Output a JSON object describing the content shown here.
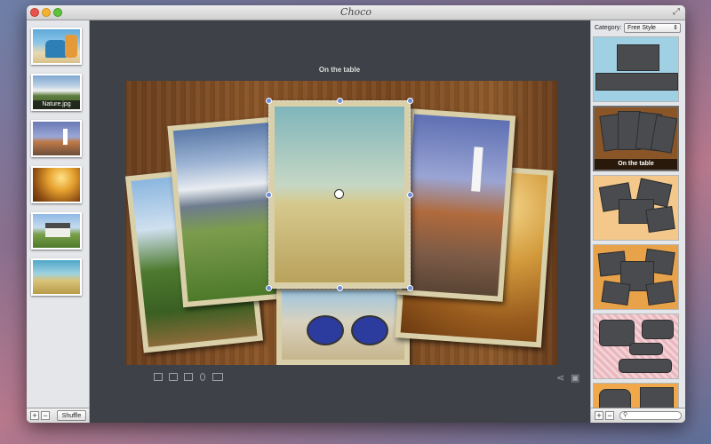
{
  "window": {
    "title": "Choco",
    "fullscreen_icon": "expand-icon"
  },
  "left_sidebar": {
    "thumbnails": [
      {
        "name": "thumb-beach-chairs",
        "label": ""
      },
      {
        "name": "thumb-nature",
        "label": "Nature.jpg"
      },
      {
        "name": "thumb-lighthouse",
        "label": ""
      },
      {
        "name": "thumb-golden-field",
        "label": ""
      },
      {
        "name": "thumb-house",
        "label": ""
      },
      {
        "name": "thumb-dirt-road",
        "label": ""
      }
    ],
    "add_label": "+",
    "remove_label": "−",
    "shuffle_label": "Shuffle"
  },
  "main": {
    "canvas_title": "On the table",
    "toolbar": [
      "crop-icon",
      "folder-icon",
      "grid-icon",
      "drop-icon",
      "frame-icon"
    ],
    "share_icon": "share-icon",
    "export_icon": "export-icon"
  },
  "right_sidebar": {
    "category_label": "Category:",
    "category_value": "Free Style",
    "layouts": [
      {
        "label": ""
      },
      {
        "label": "On the table",
        "selected": true
      },
      {
        "label": ""
      },
      {
        "label": ""
      },
      {
        "label": ""
      },
      {
        "label": ""
      }
    ],
    "add_label": "+",
    "remove_label": "−",
    "search_placeholder": ""
  },
  "colors": {
    "wood": "#8a5527",
    "selection": "#6c8bd8",
    "window_bg": "#3e4147"
  }
}
